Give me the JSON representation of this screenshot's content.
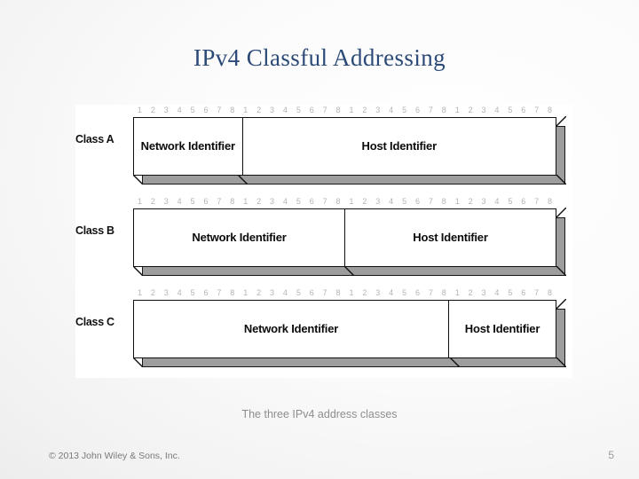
{
  "slide": {
    "title": "IPv4 Classful Addressing",
    "title_color": "#2c4a78",
    "caption": "The three IPv4 address classes",
    "footer": {
      "copyright": "© 2013 John Wiley & Sons, Inc.",
      "page_number": "5"
    },
    "background_color": "#efefef",
    "panel_color": "#ffffff"
  },
  "diagram": {
    "total_bits": 32,
    "bit_ruler": [
      "1",
      "2",
      "3",
      "4",
      "5",
      "6",
      "7",
      "8",
      "1",
      "2",
      "3",
      "4",
      "5",
      "6",
      "7",
      "8",
      "1",
      "2",
      "3",
      "4",
      "5",
      "6",
      "7",
      "8",
      "1",
      "2",
      "3",
      "4",
      "5",
      "6",
      "7",
      "8"
    ],
    "ruler_color": "#b4b4b4",
    "box_face_color": "#ffffff",
    "box_extrude_color": "#9d9d9d",
    "box_outline_color": "#101010",
    "rows": [
      {
        "label": "Class A",
        "segments": [
          {
            "name": "Network Identifier",
            "bits": 8
          },
          {
            "name": "Host Identifier",
            "bits": 24
          }
        ]
      },
      {
        "label": "Class B",
        "segments": [
          {
            "name": "Network Identifier",
            "bits": 16
          },
          {
            "name": "Host Identifier",
            "bits": 16
          }
        ]
      },
      {
        "label": "Class C",
        "segments": [
          {
            "name": "Network Identifier",
            "bits": 24
          },
          {
            "name": "Host Identifier",
            "bits": 8
          }
        ]
      }
    ]
  }
}
